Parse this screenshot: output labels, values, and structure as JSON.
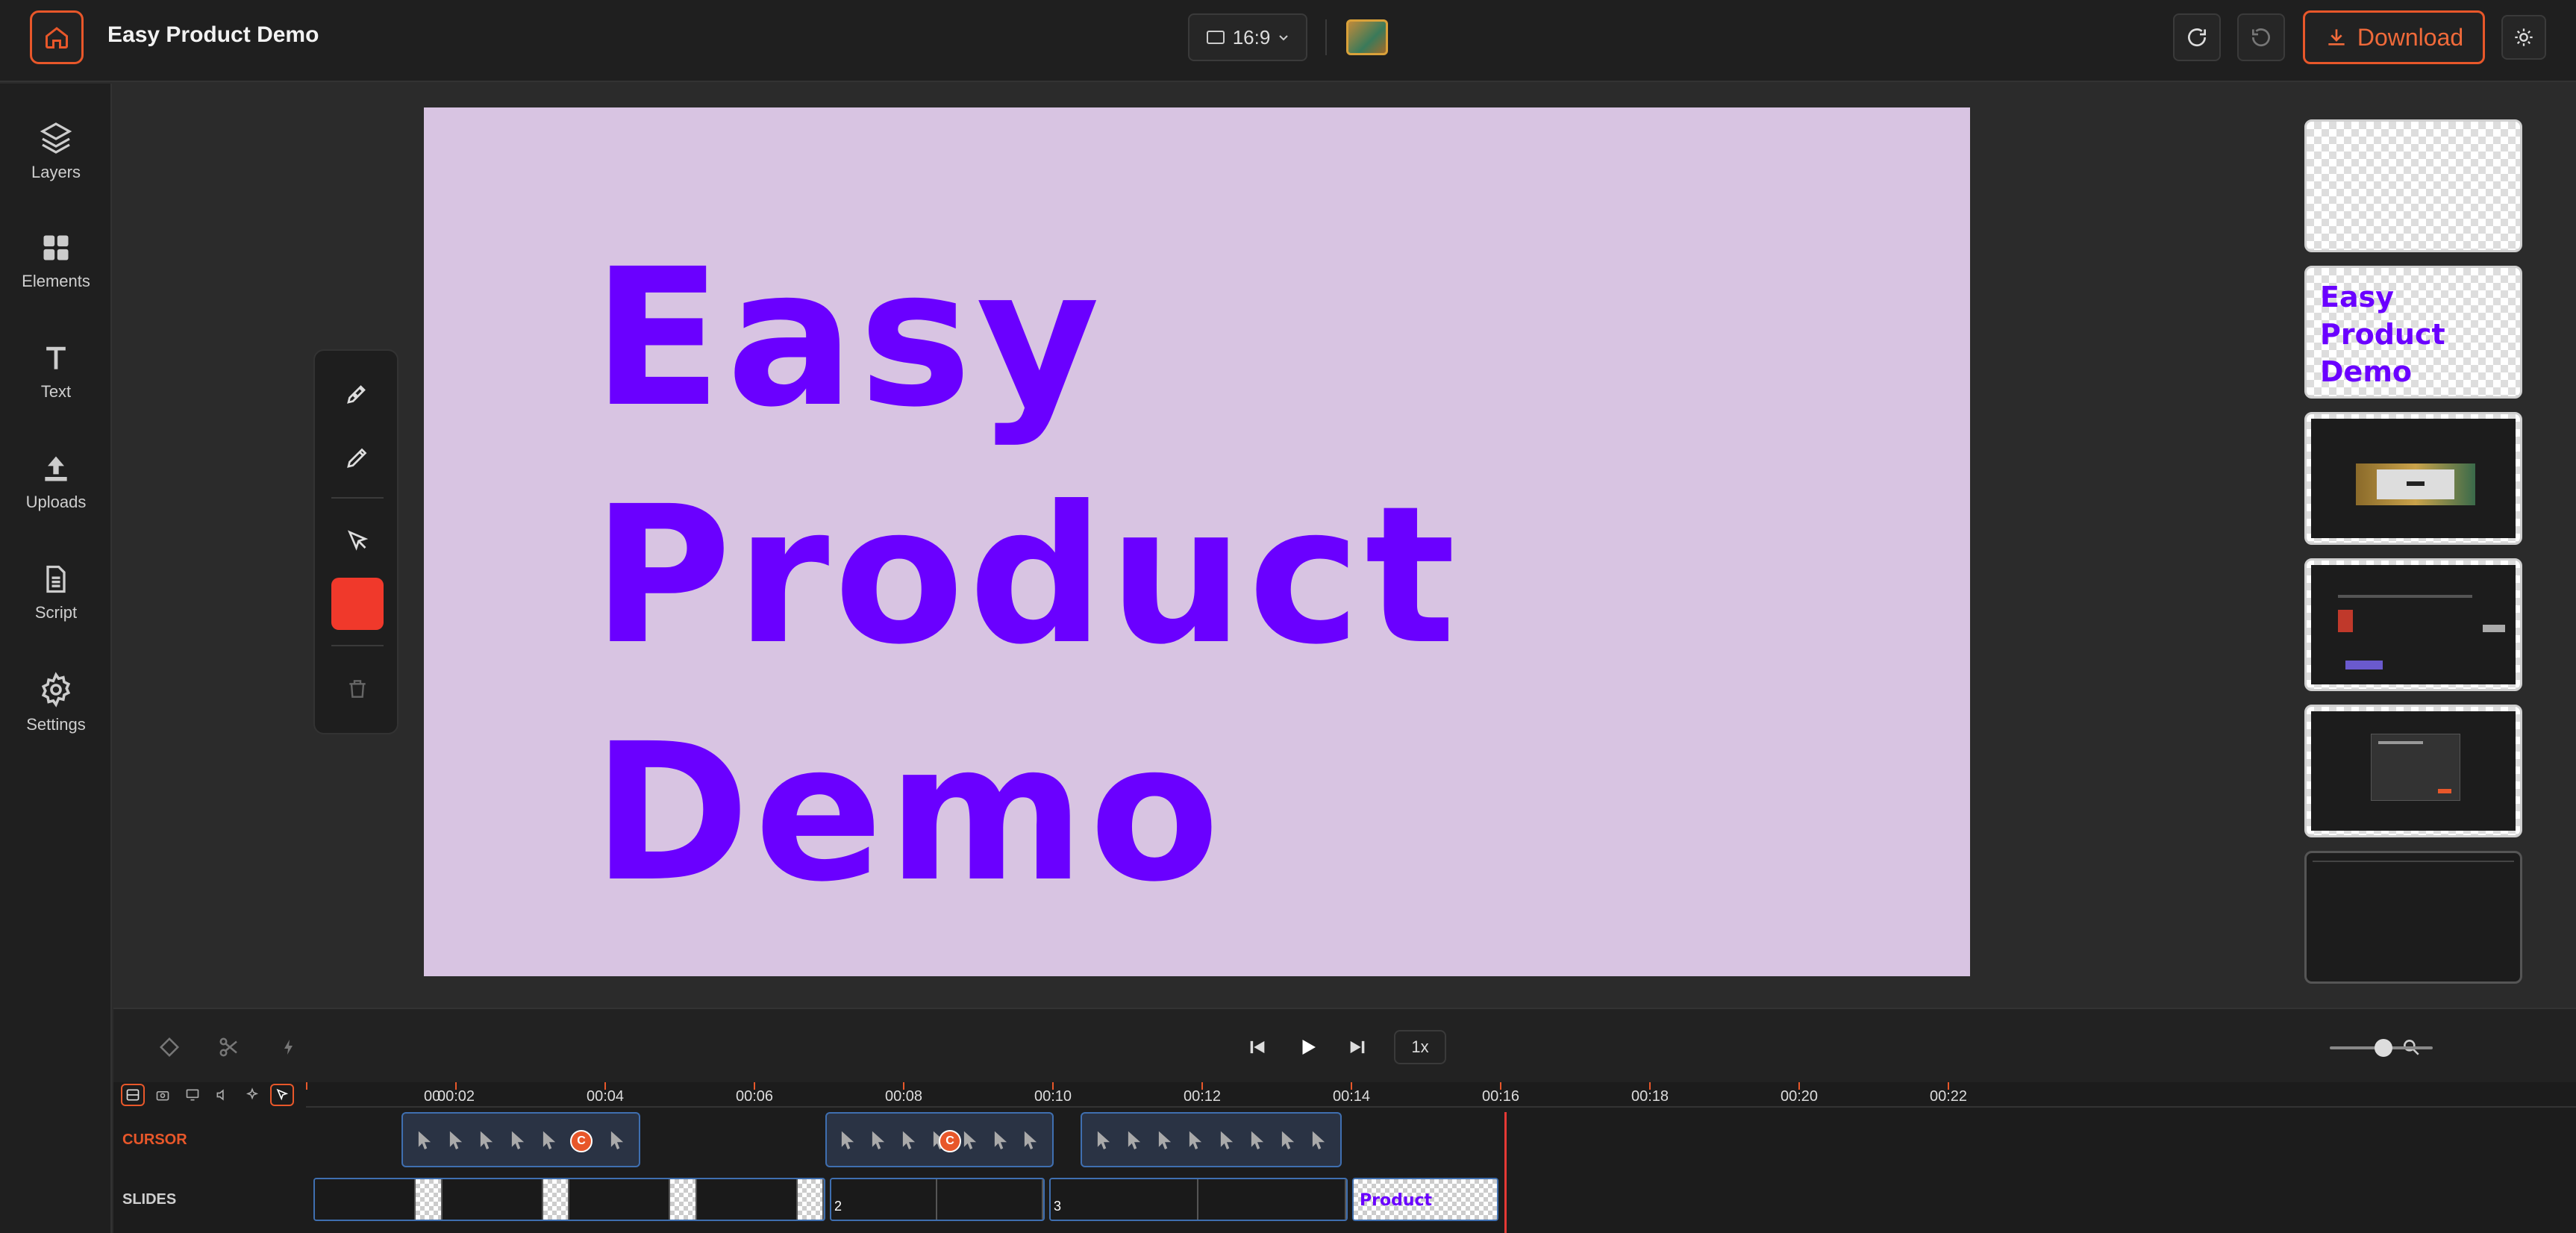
{
  "header": {
    "title": "Easy Product Demo",
    "aspect_ratio": "16:9",
    "download_label": "Download",
    "accent_color": "#e8572a"
  },
  "sidebar": {
    "items": [
      {
        "label": "Layers",
        "icon": "layers-icon"
      },
      {
        "label": "Elements",
        "icon": "grid-icon"
      },
      {
        "label": "Text",
        "icon": "text-icon"
      },
      {
        "label": "Uploads",
        "icon": "upload-icon"
      },
      {
        "label": "Script",
        "icon": "document-icon"
      },
      {
        "label": "Settings",
        "icon": "gear-icon"
      }
    ]
  },
  "canvas": {
    "background_color": "#d8c4e2",
    "text_color": "#6a00ff",
    "headline_lines": [
      "Easy",
      "Product",
      "Demo"
    ]
  },
  "tools": {
    "current_color": "#f0392b"
  },
  "slides_rail": {
    "thumb_text_lines": [
      "Easy",
      "Product",
      "Demo"
    ]
  },
  "playback": {
    "speed": "1x"
  },
  "timeline": {
    "ticks": [
      "00",
      "00:02",
      "00:04",
      "00:06",
      "00:08",
      "00:10",
      "00:12",
      "00:14",
      "00:16",
      "00:18",
      "00:20",
      "00:22"
    ],
    "tracks": {
      "cursor": "CURSOR",
      "slides": "SLIDES"
    },
    "click_marker": "C",
    "slide_numbers": [
      "2",
      "3"
    ],
    "slide_clip_text": "Product",
    "playhead_time": "00:16"
  }
}
